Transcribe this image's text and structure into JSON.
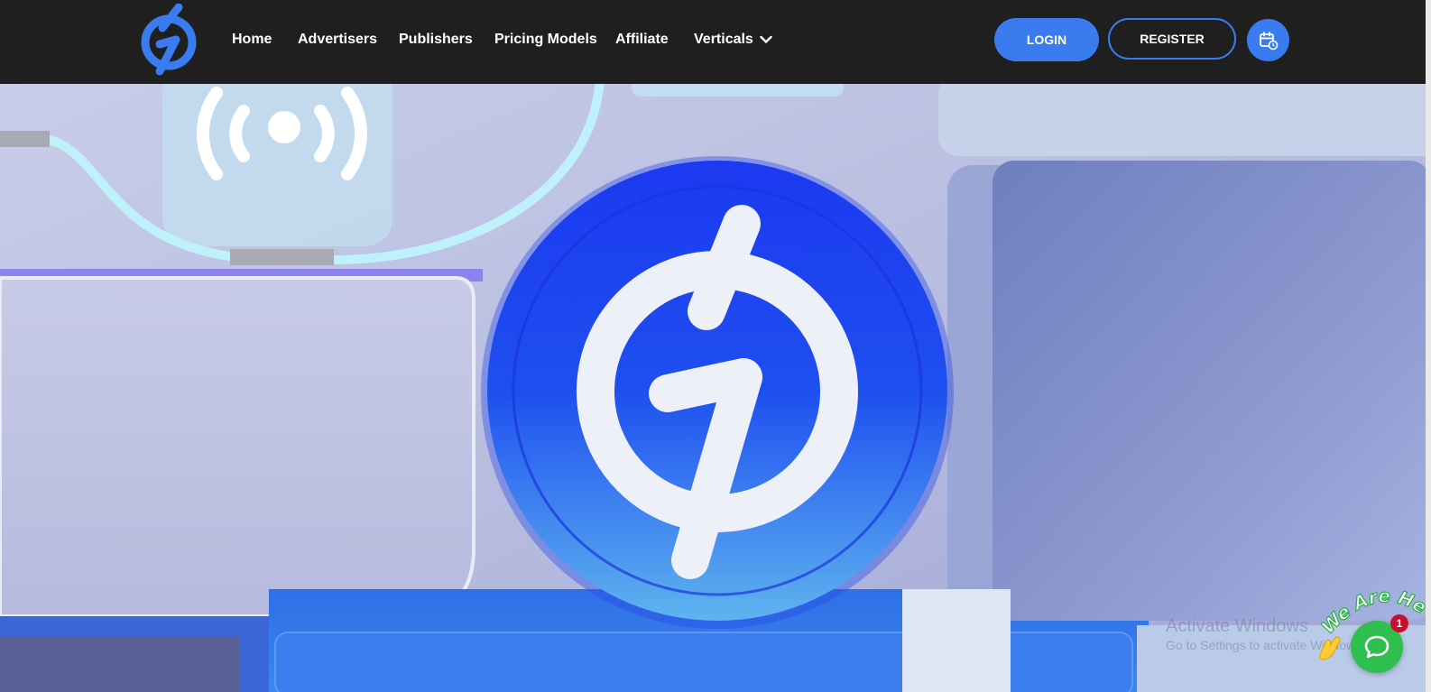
{
  "nav": {
    "links": [
      {
        "label": "Home"
      },
      {
        "label": "Advertisers"
      },
      {
        "label": "Publishers"
      },
      {
        "label": "Pricing Models"
      },
      {
        "label": "Affiliate"
      },
      {
        "label": "Verticals"
      }
    ],
    "login_label": "LOGIN",
    "register_label": "REGISTER",
    "calendar_icon": "calendar-clock-icon",
    "dropdown_icon": "chevron-down-icon"
  },
  "widget": {
    "banner_text": "We Are Here!",
    "badge_count": "1",
    "wave_icon": "waving-hand-icon",
    "chat_icon": "chat-bubble-icon"
  },
  "watermark": {
    "title": "Activate Windows",
    "subtitle": "Go to Settings to activate Windows."
  },
  "colors": {
    "nav_bg": "#1f1f1f",
    "accent": "#3a7bf0",
    "chat_green": "#2fbf4f",
    "badge_red": "#c8102e"
  }
}
